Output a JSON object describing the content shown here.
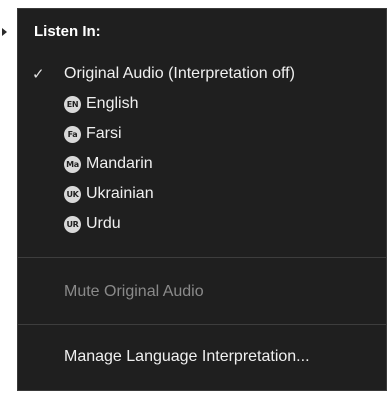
{
  "menu": {
    "heading": "Listen In:",
    "original_audio": {
      "label": "Original Audio (Interpretation off)",
      "checked": true,
      "check_glyph": "✓"
    },
    "languages": [
      {
        "badge": "EN",
        "label": "English"
      },
      {
        "badge": "Fa",
        "label": "Farsi"
      },
      {
        "badge": "Ma",
        "label": "Mandarin"
      },
      {
        "badge": "UK",
        "label": "Ukrainian"
      },
      {
        "badge": "UR",
        "label": "Urdu"
      }
    ],
    "mute_original_audio": {
      "label": "Mute Original Audio",
      "enabled": false
    },
    "manage_interpretation": {
      "label": "Manage Language Interpretation..."
    }
  },
  "colors": {
    "menu_background": "#1f1f1f",
    "text": "#f0f0f0",
    "disabled_text": "#8a8a8a",
    "badge_background": "#d9d9d9"
  }
}
